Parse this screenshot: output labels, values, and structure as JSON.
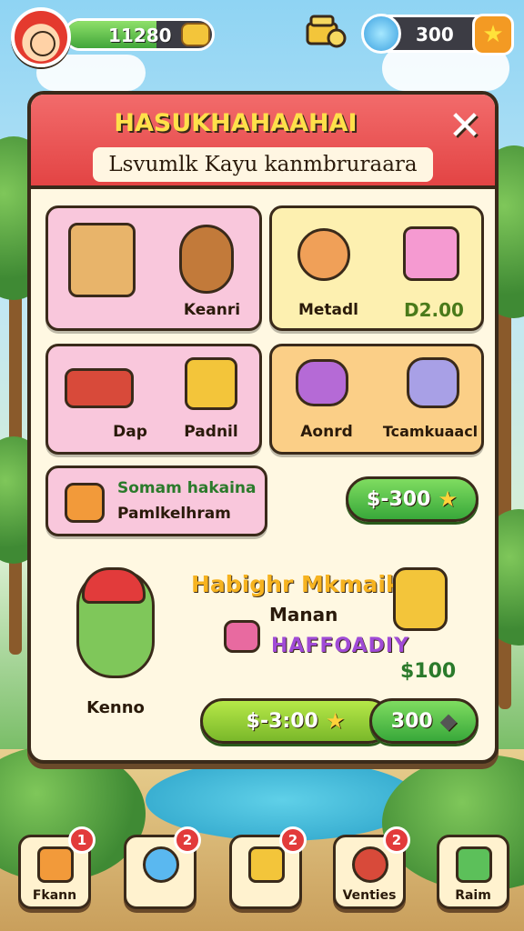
{
  "hud": {
    "xp_value": "11280",
    "xp_progress": 0.62,
    "gems_value": "300",
    "icons": [
      "player-avatar-icon",
      "coin-bag-icon",
      "treasure-icon",
      "gem-globe-icon",
      "star-icon"
    ]
  },
  "panel": {
    "title": "HASUKHAHAAHAI",
    "subtitle": "Lsvumlk Kayu kanmbruraara",
    "close_label": "✕"
  },
  "shop": {
    "row1": [
      {
        "label": "Keanri",
        "icons": [
          "crate-icon",
          "backpack-icon"
        ]
      },
      {
        "label": "Metadl",
        "icons": [
          "creature-icon"
        ]
      },
      {
        "label": "D2.00",
        "icons": [
          "cake-icon"
        ]
      }
    ],
    "row2": [
      {
        "label": "Dap",
        "icons": [
          "red-chest-icon"
        ]
      },
      {
        "label": "Padnil",
        "icons": [
          "gold-chest-icon"
        ]
      },
      {
        "label": "Aonrd",
        "icons": [
          "purple-hat-icon"
        ]
      },
      {
        "label": "Tcamkuaacl",
        "icons": [
          "potion-jar-icon"
        ]
      }
    ],
    "deal": {
      "title": "Somam hakaina",
      "subtitle": "Pamlkelhram",
      "price": "$-300",
      "icon": "fruit-box-icon"
    }
  },
  "promo": {
    "title": "Habighr Mkmaik",
    "subtitle": "Manan",
    "rainbow_text": "HAFFOADIY",
    "price_small": "$100",
    "character_label": "Kenno",
    "buy_price": "$-3:00",
    "gem_price": "300"
  },
  "nav": [
    {
      "label": "Fkann",
      "badge": "1",
      "icon": "home-icon"
    },
    {
      "label": "",
      "badge": "2",
      "icon": "magnifier-icon"
    },
    {
      "label": "",
      "badge": "2",
      "icon": "gift-icon"
    },
    {
      "label": "Venties",
      "badge": "2",
      "icon": "character-icon"
    },
    {
      "label": "Raim",
      "badge": "",
      "icon": "map-icon"
    }
  ],
  "colors": {
    "header_red": "#e34444",
    "accent_yellow": "#ffe04a",
    "button_green": "#38a83a",
    "badge_red": "#e23b3b"
  }
}
